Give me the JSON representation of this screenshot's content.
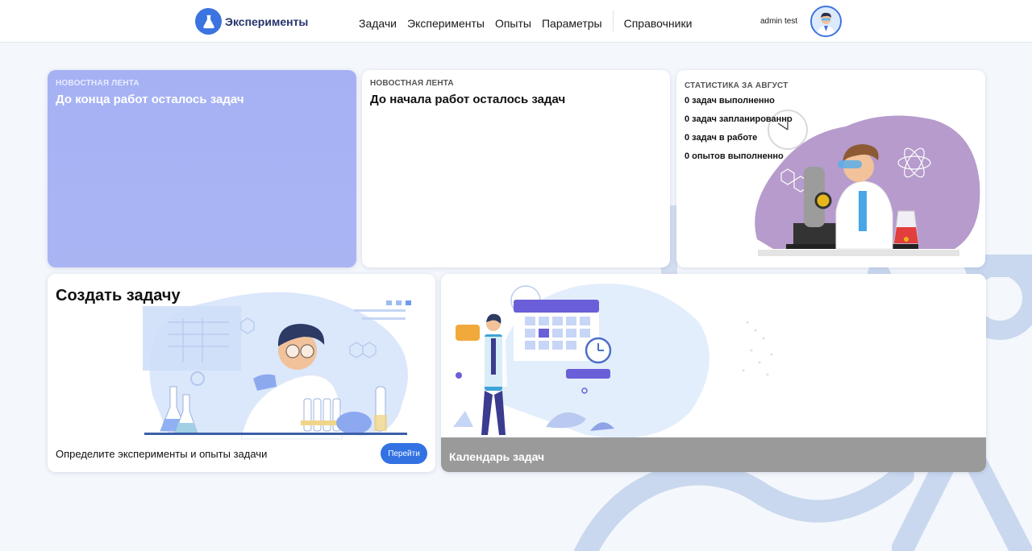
{
  "header": {
    "logo_text": "Эксперименты",
    "nav": [
      "Задачи",
      "Эксперименты",
      "Опыты",
      "Параметры"
    ],
    "nav_extra": "Справочники",
    "user_name": "admin test"
  },
  "cards": {
    "news_left": {
      "kicker": "НОВОСТНАЯ ЛЕНТА",
      "headline": "До конца работ осталось задач"
    },
    "news_right": {
      "kicker": "НОВОСТНАЯ ЛЕНТА",
      "headline": "До начала работ осталось задач"
    },
    "stats": {
      "kicker": "СТАТИСТИКА ЗА АВГУСТ",
      "lines": [
        "0 задач выполненно",
        "0 задач запланированно",
        "0 задач в работе",
        "0 опытов выполненно"
      ]
    },
    "create": {
      "title": "Создать задачу",
      "description": "Определите эксперименты и опыты задачи",
      "button": "Перейти"
    },
    "calendar": {
      "title": "Календарь задач"
    }
  },
  "colors": {
    "accent": "#3b73e0",
    "news_card": "#a6b1f4",
    "calendar_footer": "#9a9a9a",
    "page_bg": "#f4f7fc"
  },
  "icons": {
    "logo": "flask-icon",
    "avatar": "scientist-avatar"
  }
}
